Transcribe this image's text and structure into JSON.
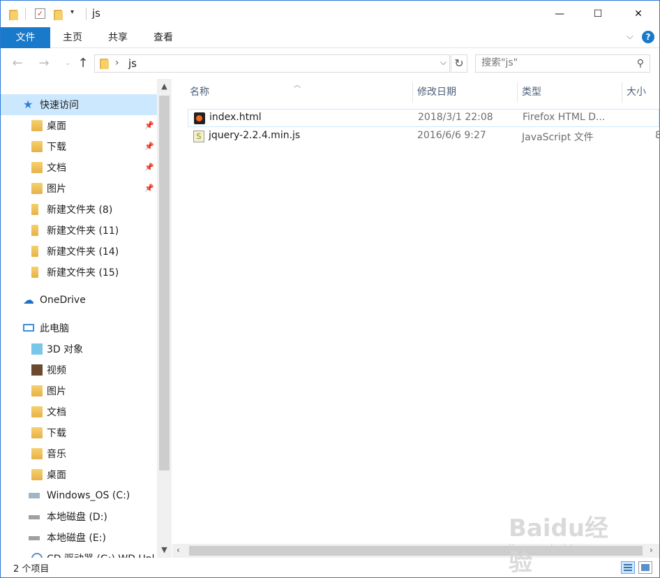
{
  "window": {
    "title": "js",
    "minimize": "—",
    "maximize": "☐",
    "close": "✕"
  },
  "ribbon": {
    "tabs": [
      "文件",
      "主页",
      "共享",
      "查看"
    ]
  },
  "address": {
    "path": "js",
    "search_placeholder": "搜索\"js\""
  },
  "navpane": {
    "quick_access": "快速访问",
    "quick_items": [
      "桌面",
      "下载",
      "文档",
      "图片",
      "新建文件夹 (8)",
      "新建文件夹 (11)",
      "新建文件夹 (14)",
      "新建文件夹 (15)"
    ],
    "onedrive": "OneDrive",
    "this_pc": "此电脑",
    "pc_items": [
      "3D 对象",
      "视频",
      "图片",
      "文档",
      "下载",
      "音乐",
      "桌面",
      "Windows_OS (C:)",
      "本地磁盘 (D:)",
      "本地磁盘 (E:)",
      "CD 驱动器 (G:) WD Unl"
    ]
  },
  "columns": {
    "name": "名称",
    "modified": "修改日期",
    "type": "类型",
    "size": "大小"
  },
  "files": [
    {
      "name": "index.html",
      "modified": "2018/3/1 22:08",
      "type": "Firefox HTML D...",
      "size": ""
    },
    {
      "name": "jquery-2.2.4.min.js",
      "modified": "2016/6/6 9:27",
      "type": "JavaScript 文件",
      "size": "8"
    }
  ],
  "status": {
    "count": "2 个项目"
  },
  "watermark": {
    "brand": "Baidu经验",
    "site": "jingyan.baidu.com"
  }
}
